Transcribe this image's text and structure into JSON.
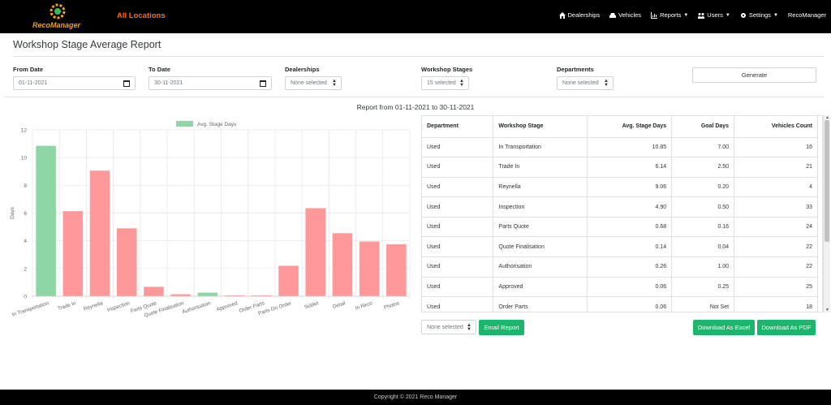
{
  "brand": {
    "logo_text": "RecoManager",
    "location": "All Locations"
  },
  "nav": [
    {
      "icon": "home-icon",
      "label": "Dealerships",
      "caret": false
    },
    {
      "icon": "car-icon",
      "label": "Vehicles",
      "caret": false
    },
    {
      "icon": "chart-icon",
      "label": "Reports",
      "caret": true
    },
    {
      "icon": "users-icon",
      "label": "Users",
      "caret": true
    },
    {
      "icon": "gear-icon",
      "label": "Settings",
      "caret": true
    },
    {
      "icon": "",
      "label": "RecoManager",
      "caret": false
    }
  ],
  "page_title": "Workshop Stage Average Report",
  "filters": {
    "from_label": "From Date",
    "from_value": "01-11-2021",
    "to_label": "To Date",
    "to_value": "30-11-2021",
    "dealerships_label": "Dealerships",
    "dealerships_value": "None selected",
    "stages_label": "Workshop Stages",
    "stages_value": "15 selected",
    "departments_label": "Departments",
    "departments_value": "None selected",
    "generate_label": "Generate"
  },
  "report_title": "Report from 01-11-2021 to 30-11-2021",
  "chart_data": {
    "type": "bar",
    "legend": "Avg. Stage Days",
    "ylabel": "Days",
    "ylim": [
      0,
      12
    ],
    "yticks": [
      0,
      2,
      4,
      6,
      8,
      10,
      12
    ],
    "categories": [
      "In Transportation",
      "Trade In",
      "Reynella",
      "Inspection",
      "Parts Quote",
      "Quote Finalisation",
      "Authorisation",
      "Approved",
      "Order Parts",
      "Parts On Order",
      "Sublet",
      "Detail",
      "In Reco",
      "Photos"
    ],
    "values": [
      10.85,
      6.14,
      9.06,
      4.9,
      0.68,
      0.14,
      0.26,
      0.06,
      0.06,
      2.2,
      6.35,
      4.55,
      3.95,
      3.75
    ],
    "colors": [
      "#8fd6a5",
      "#ff9999",
      "#ff9999",
      "#ff9999",
      "#ff9999",
      "#ff9999",
      "#8fd6a5",
      "#ff9999",
      "#ff9999",
      "#ff9999",
      "#ff9999",
      "#ff9999",
      "#ff9999",
      "#ff9999"
    ],
    "grid": true
  },
  "table": {
    "headers": [
      "Department",
      "Workshop Stage",
      "Avg. Stage Days",
      "Goal Days",
      "Vehicles Count"
    ],
    "rows": [
      [
        "Used",
        "In Transportation",
        "10.85",
        "7.00",
        "16"
      ],
      [
        "Used",
        "Trade In",
        "6.14",
        "2.50",
        "21"
      ],
      [
        "Used",
        "Reynella",
        "9.06",
        "0.20",
        "4"
      ],
      [
        "Used",
        "Inspection",
        "4.90",
        "0.50",
        "33"
      ],
      [
        "Used",
        "Parts Quote",
        "0.68",
        "0.16",
        "24"
      ],
      [
        "Used",
        "Quote Finalisation",
        "0.14",
        "0.04",
        "22"
      ],
      [
        "Used",
        "Authorisation",
        "0.26",
        "1.00",
        "22"
      ],
      [
        "Used",
        "Approved",
        "0.06",
        "0.25",
        "25"
      ],
      [
        "Used",
        "Order Parts",
        "0.06",
        "Not Set",
        "18"
      ]
    ]
  },
  "bottom": {
    "email_select": "None selected",
    "email_button": "Email Report",
    "excel_button": "Download As Excel",
    "pdf_button": "Download As PDF"
  },
  "footer": "Copyright © 2021 Reco Manager"
}
